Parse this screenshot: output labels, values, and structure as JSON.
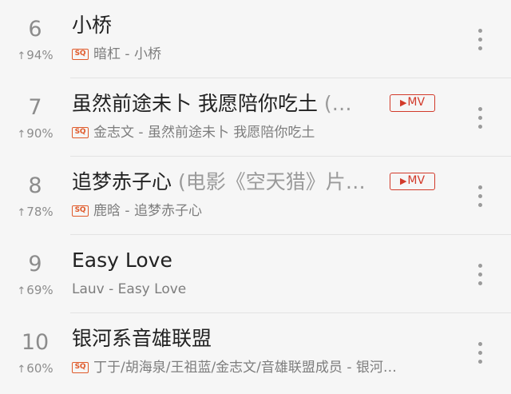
{
  "songs": [
    {
      "rank": "6",
      "trend": "94%",
      "title": "小桥",
      "title_suffix": "",
      "has_mv": false,
      "has_sq": true,
      "subtitle": "暗杠 - 小桥"
    },
    {
      "rank": "7",
      "trend": "90%",
      "title": "虽然前途未卜 我愿陪你吃土",
      "title_suffix": " (…",
      "has_mv": true,
      "has_sq": true,
      "subtitle": "金志文 - 虽然前途未卜 我愿陪你吃土"
    },
    {
      "rank": "8",
      "trend": "78%",
      "title": "追梦赤子心",
      "title_suffix": " (电影《空天猎》片…",
      "has_mv": true,
      "has_sq": true,
      "subtitle": "鹿晗 - 追梦赤子心"
    },
    {
      "rank": "9",
      "trend": "69%",
      "title": "Easy Love",
      "title_suffix": "",
      "has_mv": false,
      "has_sq": false,
      "subtitle": "Lauv - Easy Love"
    },
    {
      "rank": "10",
      "trend": "60%",
      "title": "银河系音雄联盟",
      "title_suffix": "",
      "has_mv": false,
      "has_sq": true,
      "subtitle": "丁于/胡海泉/王祖蓝/金志文/音雄联盟成员 - 银河…"
    }
  ],
  "labels": {
    "mv": "MV",
    "sq": "SQ",
    "trend_arrow": "↑",
    "play_glyph": "▶"
  },
  "colors": {
    "background": "#f6f6f6",
    "accent_red": "#d23a2a",
    "sq_orange": "#e05a2a",
    "muted": "#8c8c8c"
  },
  "icons": {
    "more": "more-vertical-icon",
    "play": "play-icon",
    "trend": "arrow-up-icon"
  }
}
